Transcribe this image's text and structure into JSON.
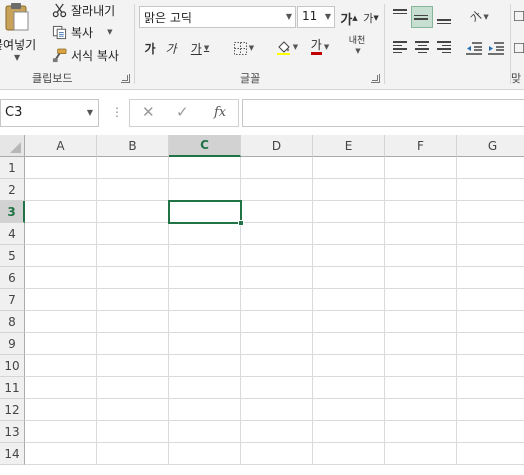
{
  "ribbon": {
    "clipboard": {
      "paste_label": "붙여넣기",
      "cut_label": "잘라내기",
      "copy_label": "복사",
      "format_painter_label": "서식 복사",
      "group_label": "클립보드"
    },
    "font": {
      "font_name": "맑은 고딕",
      "font_size": "11",
      "grow_label": "가",
      "shrink_label": "가",
      "bold_label": "가",
      "italic_label": "가",
      "underline_label": "가",
      "font_color_label": "가",
      "phonetic_label": "내천",
      "group_label": "글꼴"
    },
    "alignment": {
      "orientation_label": "가",
      "group_label": "맞"
    }
  },
  "formula_bar": {
    "name_box": "C3",
    "dots": "⋮",
    "cancel": "✕",
    "enter": "✓",
    "fx": "fx",
    "formula": ""
  },
  "sheet": {
    "columns": [
      "A",
      "B",
      "C",
      "D",
      "E",
      "F",
      "G"
    ],
    "rows": [
      "1",
      "2",
      "3",
      "4",
      "5",
      "6",
      "7",
      "8",
      "9",
      "10",
      "11",
      "12",
      "13",
      "14"
    ],
    "active_cell": "C3",
    "active_column": "C",
    "active_row": "3"
  },
  "colors": {
    "accent": "#217346",
    "ribbon_bg": "#f3f3f3",
    "header_bg": "#f0f0f0",
    "header_active_bg": "#d2d2d2",
    "gridline": "#dadada"
  }
}
